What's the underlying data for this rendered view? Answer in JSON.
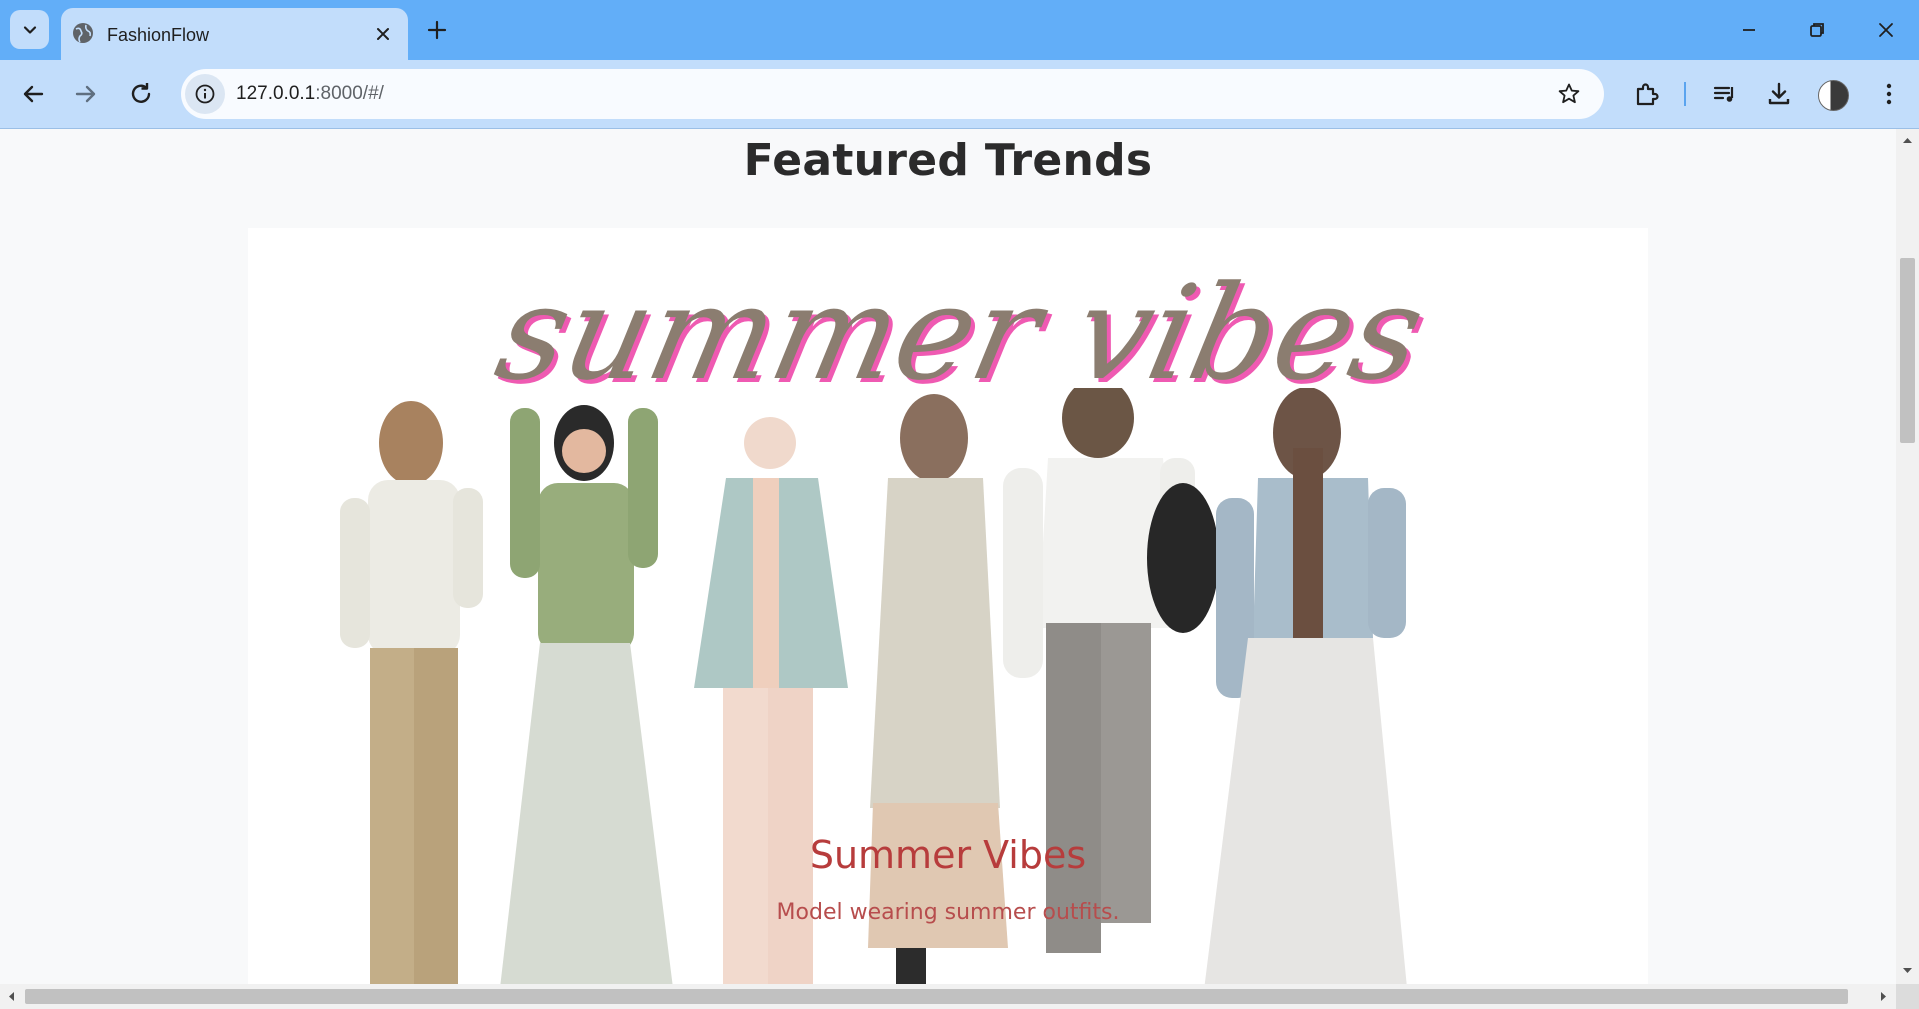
{
  "browser": {
    "tab_title": "FashionFlow",
    "url_host": "127.0.0.1",
    "url_rest": ":8000/#/",
    "icons": {
      "tab_search": "chevron-down-icon",
      "favicon": "globe-icon",
      "tab_close": "close-icon",
      "new_tab": "plus-icon",
      "back": "arrow-left-icon",
      "forward": "arrow-right-icon",
      "reload": "reload-icon",
      "site_info": "info-icon",
      "bookmark": "star-icon",
      "extensions": "puzzle-icon",
      "media": "media-control-icon",
      "downloads": "download-icon",
      "menu": "kebab-menu-icon"
    },
    "colors": {
      "frame": "#62aef8",
      "toolbar": "#c2ddfb"
    }
  },
  "page": {
    "heading": "Featured Trends",
    "card": {
      "banner_text": "summer vibes",
      "title": "Summer Vibes",
      "caption": "Model wearing summer outfits.",
      "title_color": "#b73c3c"
    }
  }
}
